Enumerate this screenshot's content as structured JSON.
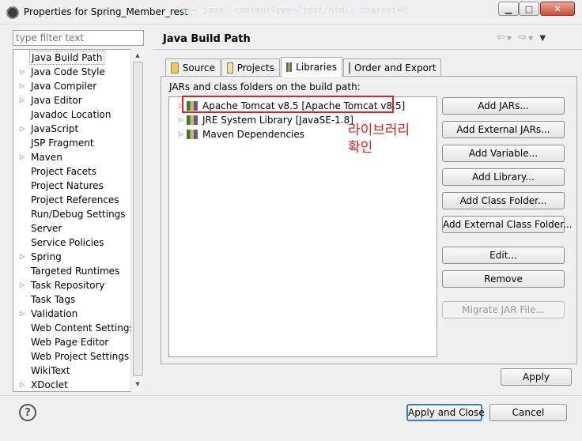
{
  "window": {
    "title": "Properties for Spring_Member_rest",
    "background_ghost_text": "ge=\"java\" contentType=\"text/html; charset=U"
  },
  "filter": {
    "placeholder": "type filter text"
  },
  "tree": {
    "items": [
      {
        "label": "Java Build Path",
        "expandable": false,
        "selected": true
      },
      {
        "label": "Java Code Style",
        "expandable": true
      },
      {
        "label": "Java Compiler",
        "expandable": true
      },
      {
        "label": "Java Editor",
        "expandable": true
      },
      {
        "label": "Javadoc Location",
        "expandable": false
      },
      {
        "label": "JavaScript",
        "expandable": true
      },
      {
        "label": "JSP Fragment",
        "expandable": false
      },
      {
        "label": "Maven",
        "expandable": true
      },
      {
        "label": "Project Facets",
        "expandable": false
      },
      {
        "label": "Project Natures",
        "expandable": false
      },
      {
        "label": "Project References",
        "expandable": false
      },
      {
        "label": "Run/Debug Settings",
        "expandable": false
      },
      {
        "label": "Server",
        "expandable": false
      },
      {
        "label": "Service Policies",
        "expandable": false
      },
      {
        "label": "Spring",
        "expandable": true
      },
      {
        "label": "Targeted Runtimes",
        "expandable": false
      },
      {
        "label": "Task Repository",
        "expandable": true
      },
      {
        "label": "Task Tags",
        "expandable": false
      },
      {
        "label": "Validation",
        "expandable": true
      },
      {
        "label": "Web Content Settings",
        "expandable": false
      },
      {
        "label": "Web Page Editor",
        "expandable": false
      },
      {
        "label": "Web Project Settings",
        "expandable": false
      },
      {
        "label": "WikiText",
        "expandable": false
      },
      {
        "label": "XDoclet",
        "expandable": true
      }
    ]
  },
  "page": {
    "title": "Java Build Path"
  },
  "tabs": [
    {
      "label": "Source",
      "icon": "source-folder-icon",
      "active": false
    },
    {
      "label": "Projects",
      "icon": "projects-icon",
      "active": false
    },
    {
      "label": "Libraries",
      "icon": "libraries-icon",
      "active": true
    },
    {
      "label": "Order and Export",
      "icon": "order-export-icon",
      "active": false
    }
  ],
  "libraries": {
    "label": "JARs and class folders on the build path:",
    "items": [
      {
        "label": "Apache Tomcat v8.5 [Apache Tomcat v8.5]",
        "highlighted": true
      },
      {
        "label": "JRE System Library [JavaSE-1.8]",
        "highlighted": false
      },
      {
        "label": "Maven Dependencies",
        "highlighted": false
      }
    ],
    "annotation_line1": "라이브러리",
    "annotation_line2": "확인"
  },
  "buttons": {
    "add_jars": "Add JARs...",
    "add_external_jars": "Add External JARs...",
    "add_variable": "Add Variable...",
    "add_library": "Add Library...",
    "add_class_folder": "Add Class Folder...",
    "add_external_class_folder": "Add External Class Folder...",
    "edit": "Edit...",
    "remove": "Remove",
    "migrate_jar": "Migrate JAR File...",
    "apply": "Apply",
    "apply_and_close": "Apply and Close",
    "cancel": "Cancel"
  },
  "colors": {
    "annotation": "#e02020",
    "default_button_border": "#3c7fb1"
  }
}
